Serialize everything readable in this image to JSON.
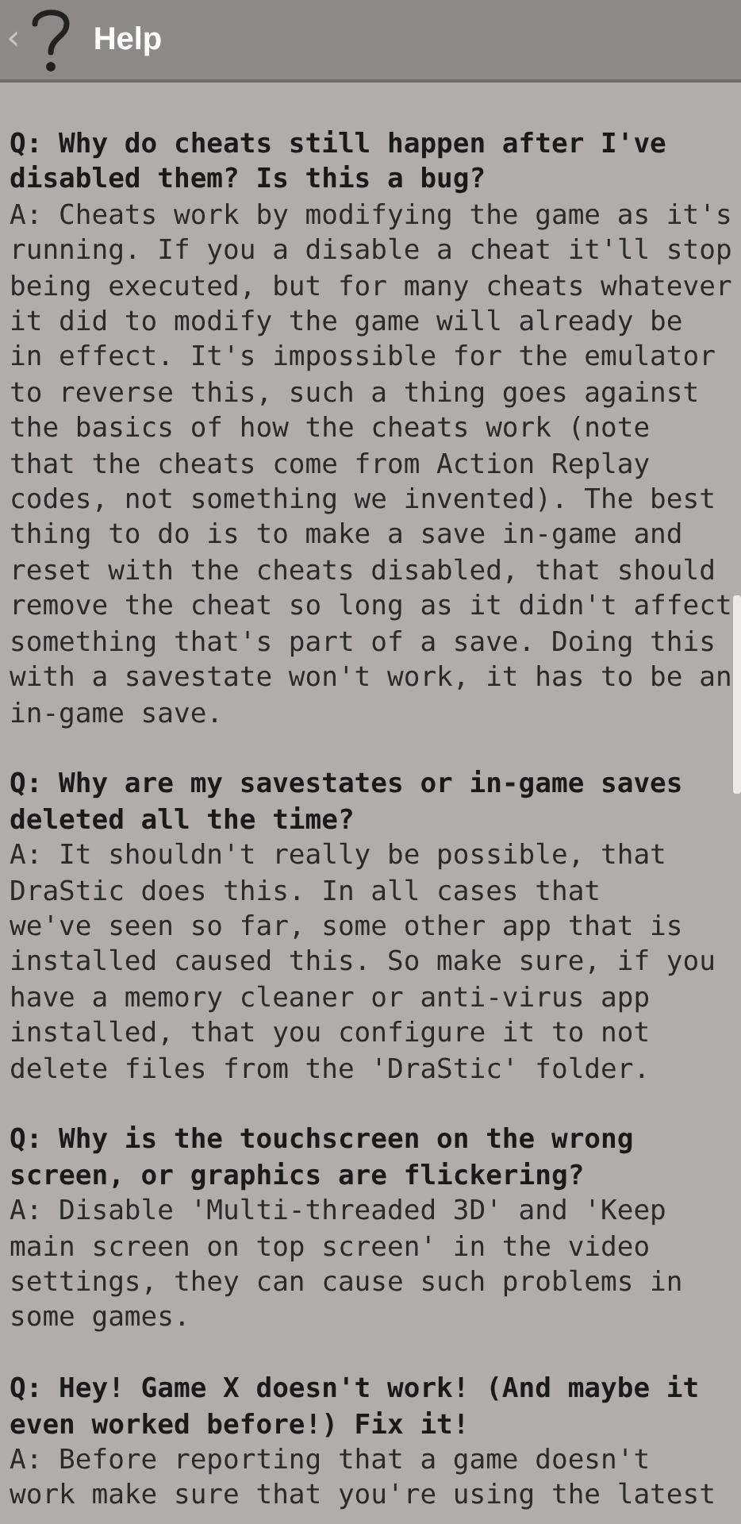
{
  "header": {
    "back": "‹",
    "title": "Help"
  },
  "faq": [
    {
      "question": "Q: Why do cheats still happen after I've\ndisabled them? Is this a bug?",
      "answer": "A: Cheats work by modifying the game as it's\nrunning. If you a disable a cheat it'll stop\nbeing executed, but for many cheats whatever\nit did to modify the game will already be\nin effect. It's impossible for the emulator\nto reverse this, such a thing goes against\nthe basics of how the cheats work (note\nthat the cheats come from Action Replay\ncodes, not something we invented). The best\nthing to do is to make a save in-game and\nreset with the cheats disabled, that should\nremove the cheat so long as it didn't affect\nsomething that's part of a save. Doing this\nwith a savestate won't work, it has to be an\nin-game save."
    },
    {
      "question": "Q: Why are my savestates or in-game saves\ndeleted all the time?",
      "answer": "A: It shouldn't really be possible, that\nDraStic does this. In all cases that\nwe've seen so far, some other app that is\ninstalled caused this. So make sure, if you\nhave a memory cleaner or anti-virus app\ninstalled, that you configure it to not\ndelete files from the 'DraStic' folder."
    },
    {
      "question": "Q: Why is the touchscreen on the wrong\nscreen, or graphics are flickering?",
      "answer": "A: Disable 'Multi-threaded 3D' and 'Keep\nmain screen on top screen' in the video\nsettings, they can cause such problems in\nsome games."
    },
    {
      "question": "Q: Hey! Game X doesn't work! (And maybe it\neven worked before!) Fix it!",
      "answer": "A: Before reporting that a game doesn't\nwork make sure that you're using the latest"
    }
  ]
}
